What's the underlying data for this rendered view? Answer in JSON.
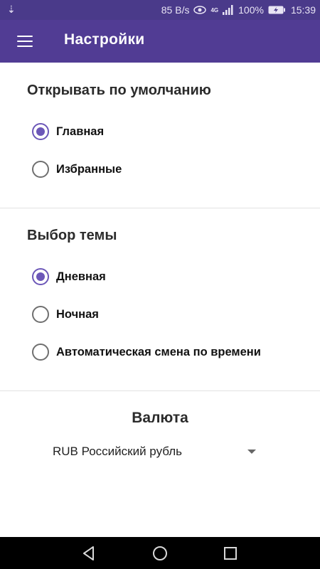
{
  "status_bar": {
    "network_speed": "85 B/s",
    "network_type": "4G",
    "battery_percent": "100%",
    "time": "15:39",
    "icons": [
      "usb-icon",
      "eye-icon",
      "signal-icon",
      "battery-icon"
    ]
  },
  "app_bar": {
    "title": "Настройки",
    "menu_icon": "menu-icon",
    "background_color": "#513c94"
  },
  "default_open": {
    "title": "Открывать по умолчанию",
    "options": [
      {
        "label": "Главная",
        "checked": true
      },
      {
        "label": "Избранные",
        "checked": false
      }
    ]
  },
  "theme": {
    "title": "Выбор темы",
    "options": [
      {
        "label": "Дневная",
        "checked": true
      },
      {
        "label": "Ночная",
        "checked": false
      },
      {
        "label": "Автоматическая смена по времени",
        "checked": false
      }
    ]
  },
  "currency": {
    "title": "Валюта",
    "selected": "RUB Российский рубль"
  },
  "nav_bar": {
    "buttons": [
      "back-icon",
      "home-icon",
      "recents-icon"
    ]
  },
  "colors": {
    "accent": "#6c57b8",
    "status_bar": "#4a3a8a"
  }
}
